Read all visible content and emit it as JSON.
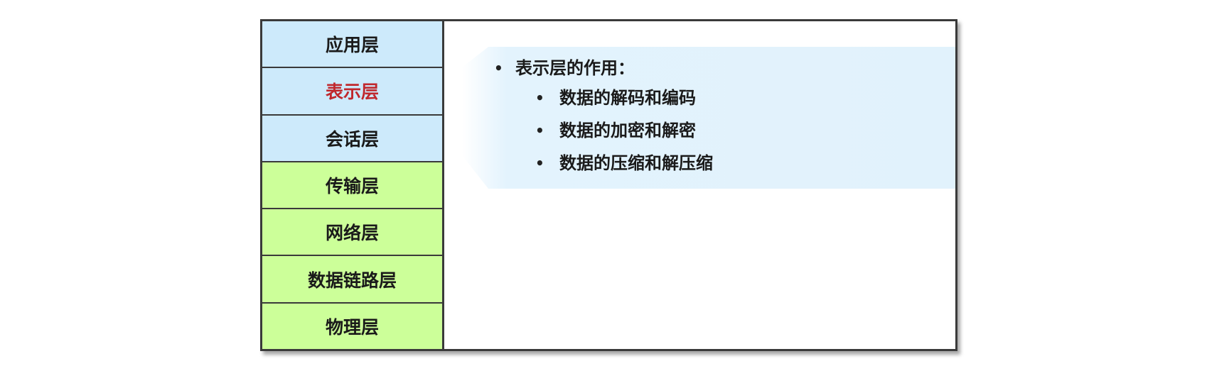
{
  "layers": [
    {
      "label": "应用层",
      "group": "upper"
    },
    {
      "label": "表示层",
      "group": "upper",
      "highlighted": true
    },
    {
      "label": "会话层",
      "group": "upper"
    },
    {
      "label": "传输层",
      "group": "lower"
    },
    {
      "label": "网络层",
      "group": "lower"
    },
    {
      "label": "数据链路层",
      "group": "lower"
    },
    {
      "label": "物理层",
      "group": "lower"
    }
  ],
  "callout": {
    "heading": "表示层的作用：",
    "items": [
      "数据的解码和编码",
      "数据的加密和解密",
      "数据的压缩和解压缩"
    ]
  },
  "colors": {
    "upper_layers": "#cdeafb",
    "lower_layers": "#ccff99",
    "highlight_text": "#c0282d",
    "callout_fill": "#e3f3fd"
  }
}
